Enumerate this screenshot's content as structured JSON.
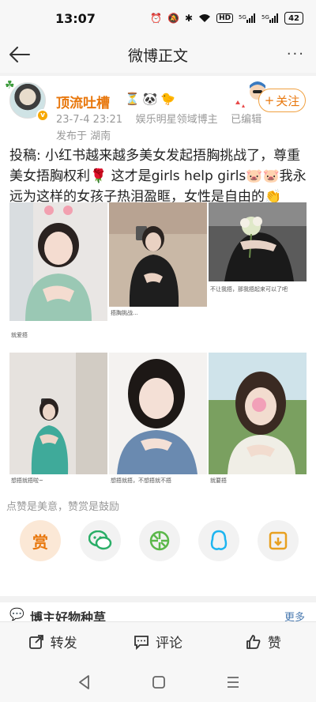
{
  "status_bar": {
    "time": "13:07",
    "hd_label": "HD",
    "signal1": "5G",
    "signal2": "5G",
    "battery": "42"
  },
  "nav": {
    "title": "微博正文",
    "more": "···"
  },
  "post": {
    "username": "顶流吐槽",
    "timestamp": "23-7-4 23:21",
    "source": "娱乐明星领域博主",
    "edited": "已编辑",
    "location": "发布于 湖南",
    "follow_label": "关注",
    "verified_mark": "v",
    "text": "投稿: 小红书越来越多美女发起捂胸挑战了，尊重美女捂胸权利🌹 这才是girls help girls🐷🐷我永远为这样的女孩子热泪盈眶，女性是自由的👏",
    "images": [
      {
        "caption": "就爱捂"
      },
      {
        "caption": "捂胸挑战..."
      },
      {
        "caption": "不让我捂，那我捂起来可以了吧"
      },
      {
        "caption": "想捂就捂啦~"
      },
      {
        "caption": "想捂就捂，不想捂就不捂"
      },
      {
        "caption": "就要捂"
      }
    ]
  },
  "appreciate": {
    "text": "点赞是美意，赞赏是鼓励",
    "reward_label": "赏"
  },
  "section": {
    "title": "博主好物种草",
    "more": "更多"
  },
  "actions": {
    "repost": "转发",
    "comment": "评论",
    "like": "赞"
  },
  "colors": {
    "accent": "#e8770c",
    "username": "#e8770c",
    "meta": "#999999"
  }
}
